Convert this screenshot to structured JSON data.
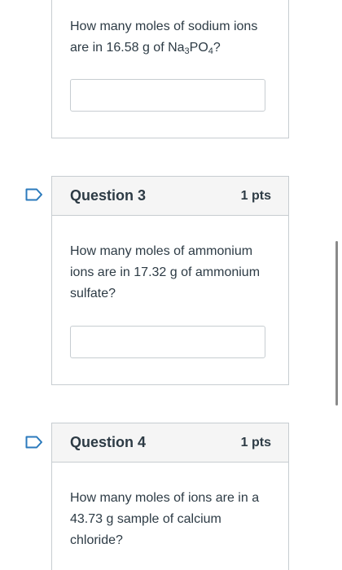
{
  "question_2": {
    "text_before": "How many moles of sodium ions are in 16.58 g of Na",
    "sub1": "3",
    "text_mid": "PO",
    "sub2": "4",
    "text_after": "?"
  },
  "question_3": {
    "title": "Question 3",
    "points": "1 pts",
    "text": "How many moles of ammonium ions are in 17.32 g of ammonium sulfate?"
  },
  "question_4": {
    "title": "Question 4",
    "points": "1 pts",
    "text": "How many moles of ions are in a 43.73 g sample of calcium chloride?"
  },
  "icons": {
    "flag": "bookmark-flag-icon"
  },
  "colors": {
    "accent": "#2b7abc",
    "border": "#c7cdd1",
    "header_bg": "#f5f5f5",
    "text": "#2d3b45"
  }
}
